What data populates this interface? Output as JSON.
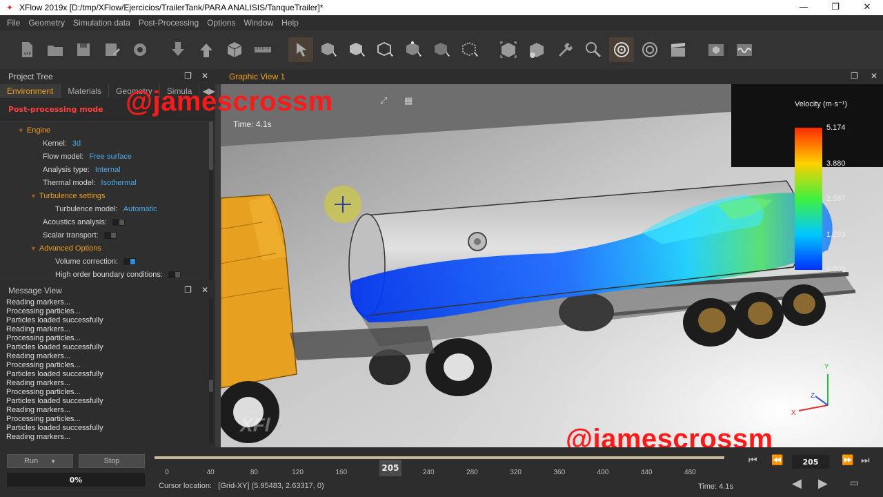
{
  "window": {
    "title": "XFlow 2019x [D:/tmp/XFlow/Ejercicios/TrailerTank/PARA ANALISIS/TanqueTrailer]*",
    "minimize": "—",
    "maximize": "❐",
    "close": "✕"
  },
  "menu": [
    "File",
    "Geometry",
    "Simulation data",
    "Post-Processing",
    "Options",
    "Window",
    "Help"
  ],
  "toolbar_icons": [
    "new-file-icon",
    "open-folder-icon",
    "save-icon",
    "save-as-icon",
    "settings-gear-icon",
    "import-icon",
    "export-icon",
    "cube-icon",
    "ruler-icon",
    "select-arrow-icon",
    "select-solid-icon",
    "select-face-icon",
    "select-edge-icon",
    "select-vertex-icon",
    "select-part-icon",
    "select-mesh-icon",
    "bounding-box-icon",
    "remove-part-icon",
    "tools-wrench-icon",
    "zoom-region-icon",
    "probe-point-icon",
    "probe-surface-icon",
    "clapper-icon",
    "box-view-icon",
    "wave-icon"
  ],
  "project_tree": {
    "title": "Project Tree",
    "tabs": [
      "Environment",
      "Materials",
      "Geometry",
      "Simula"
    ],
    "active_tab": 0,
    "mode": "Post-processing mode",
    "rows": [
      {
        "label": "Engine",
        "type": "section"
      },
      {
        "label": "Kernel:",
        "value": "3d"
      },
      {
        "label": "Flow model:",
        "value": "Free surface"
      },
      {
        "label": "Analysis type:",
        "value": "Internal"
      },
      {
        "label": "Thermal model:",
        "value": "Isothermal"
      },
      {
        "label": "Turbulence settings",
        "type": "section"
      },
      {
        "label": "Turbulence model:",
        "value": "Automatic"
      },
      {
        "label": "Acoustics analysis:",
        "toggle": false
      },
      {
        "label": "Scalar transport:",
        "toggle": false
      },
      {
        "label": "Advanced Options",
        "type": "section"
      },
      {
        "label": "Volume correction:",
        "toggle": true
      },
      {
        "label": "High order boundary conditions:",
        "toggle": false
      }
    ]
  },
  "message_view": {
    "title": "Message View",
    "lines": [
      "Reading markers...",
      "Processing particles...",
      "Particles loaded successfully",
      "Reading markers...",
      "Processing particles...",
      "Particles loaded successfully",
      "Reading markers...",
      "Processing particles...",
      "Particles loaded successfully",
      "Reading markers...",
      "Processing particles...",
      "Particles loaded successfully",
      "Reading markers...",
      "Processing particles...",
      "Particles loaded successfully",
      "Reading markers..."
    ]
  },
  "graphic_view": {
    "title": "Graphic View 1",
    "time_label": "Time: 4.1s",
    "legend_title": "Velocity (m·s⁻¹)",
    "legend_values": [
      "5.174",
      "3.880",
      "2.587",
      "1.293",
      "0.000"
    ],
    "axis_x": "X",
    "axis_y": "Y",
    "axis_z": "Z",
    "watermark_text": "XFl",
    "colors": {
      "fluid": "#1a5fff",
      "truck_cab": "#e8a020",
      "tank": "#d8d8d8"
    }
  },
  "watermark": "@jamescrossm",
  "controls": {
    "run": "Run",
    "stop": "Stop",
    "progress": "0%",
    "progress_value": 0
  },
  "timeline": {
    "ticks": [
      "0",
      "40",
      "80",
      "120",
      "160",
      "240",
      "280",
      "320",
      "360",
      "400",
      "440",
      "480"
    ],
    "current": "205",
    "frame": "205",
    "max": 500
  },
  "status": {
    "cursor_label": "Cursor location:",
    "cursor_value": "[Grid-XY] (5.95483, 2.63317, 0)",
    "time": "Time: 4.1s"
  }
}
